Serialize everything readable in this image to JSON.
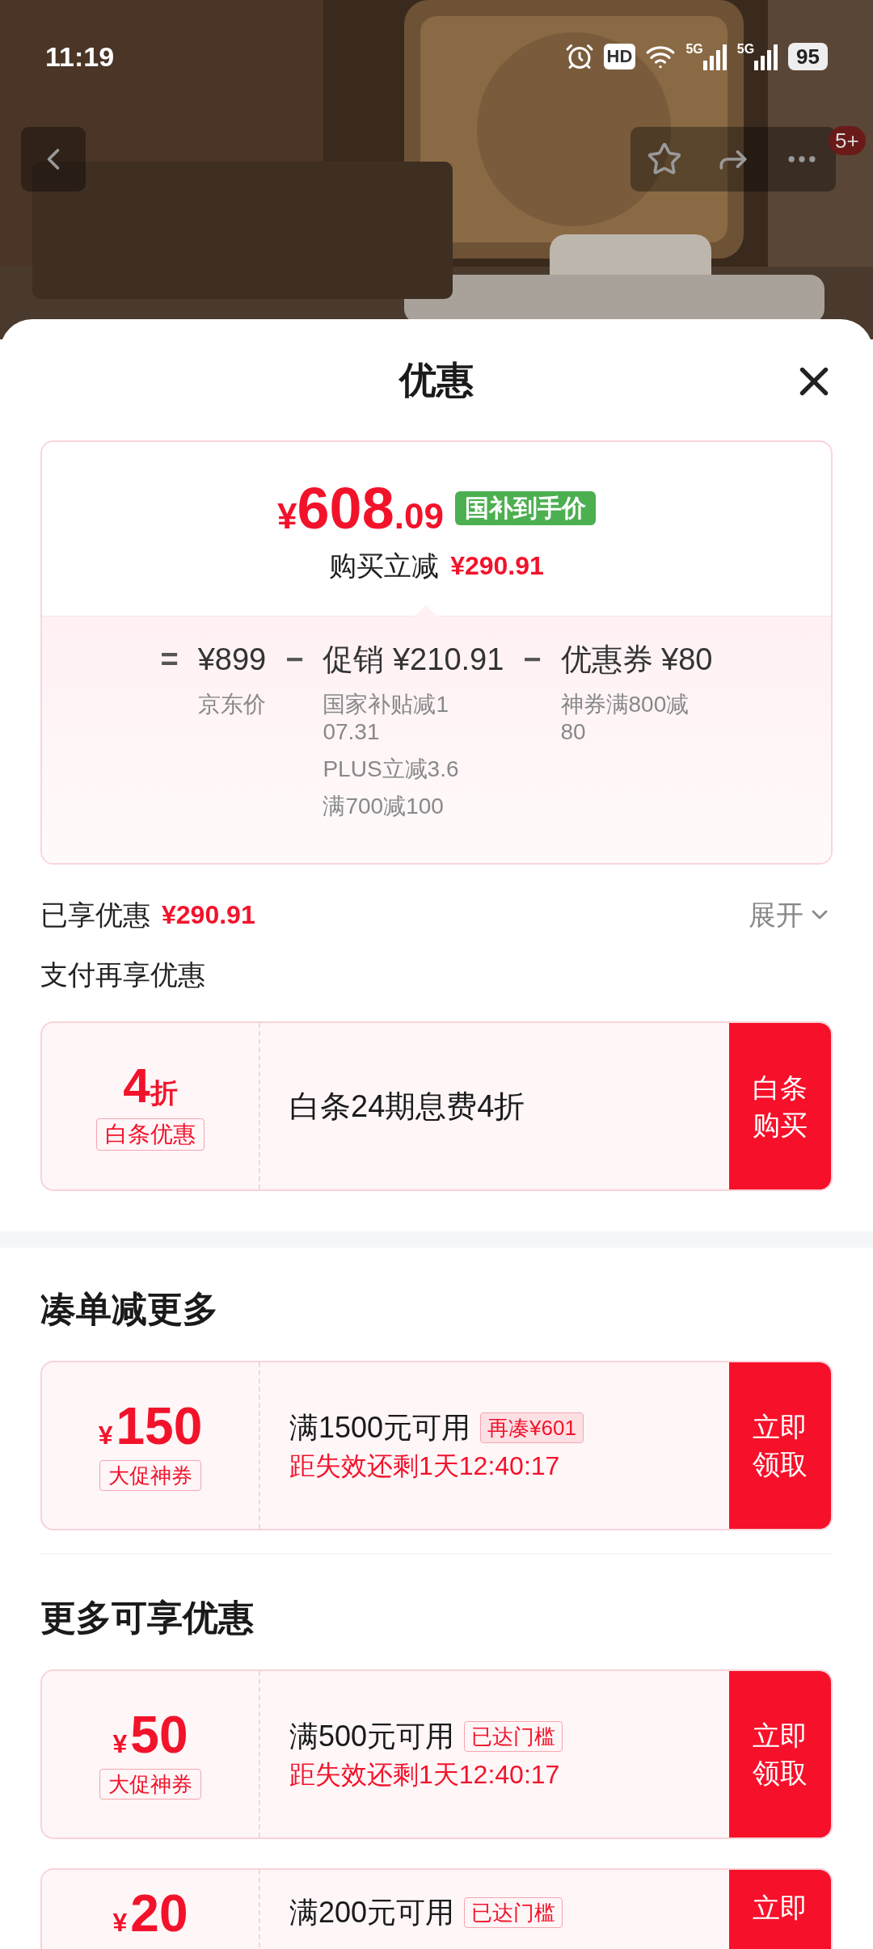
{
  "status_bar": {
    "time": "11:19",
    "hd": "HD",
    "networks": [
      "5G",
      "5G"
    ],
    "battery": "95"
  },
  "nav": {
    "badge": "5+"
  },
  "sheet": {
    "title": "优惠"
  },
  "price_card": {
    "currency": "¥",
    "integer": "608",
    "decimal": ".09",
    "tag": "国补到手价",
    "saving_label": "购买立减",
    "saving": "¥290.91",
    "breakdown": [
      {
        "operator": "=",
        "value": "¥899",
        "notes": [
          "京东价"
        ]
      },
      {
        "operator": "−",
        "value": "促销 ¥210.91",
        "notes": [
          "国家补贴减107.31",
          "PLUS立减3.6",
          "满700减100"
        ]
      },
      {
        "operator": "−",
        "value": "优惠券 ¥80",
        "notes": [
          "神券满800减80"
        ]
      }
    ]
  },
  "enjoyed": {
    "label": "已享优惠",
    "amount": "¥290.91",
    "toggle": "展开",
    "expanded": false
  },
  "payment": {
    "title": "支付再享优惠",
    "card": {
      "value": "4",
      "unit": "折",
      "tag": "白条优惠",
      "description": "白条24期息费4折",
      "button": "白条购买"
    }
  },
  "sections": [
    {
      "title": "凑单减更多",
      "coupons": [
        {
          "currency": "¥",
          "amount": "150",
          "tag": "大促神券",
          "condition": "满1500元可用",
          "badge": {
            "kind": "shortfall",
            "text": "再凑¥601"
          },
          "expiry": "距失效还剩1天12:40:17",
          "button": "立即领取"
        }
      ]
    },
    {
      "title": "更多可享优惠",
      "coupons": [
        {
          "currency": "¥",
          "amount": "50",
          "tag": "大促神券",
          "condition": "满500元可用",
          "badge": {
            "kind": "reached",
            "text": "已达门槛"
          },
          "expiry": "距失效还剩1天12:40:17",
          "button": "立即领取"
        },
        {
          "currency": "¥",
          "amount": "20",
          "condition": "满200元可用",
          "badge": {
            "kind": "reached",
            "text": "已达门槛"
          },
          "button": "立即"
        }
      ]
    }
  ]
}
